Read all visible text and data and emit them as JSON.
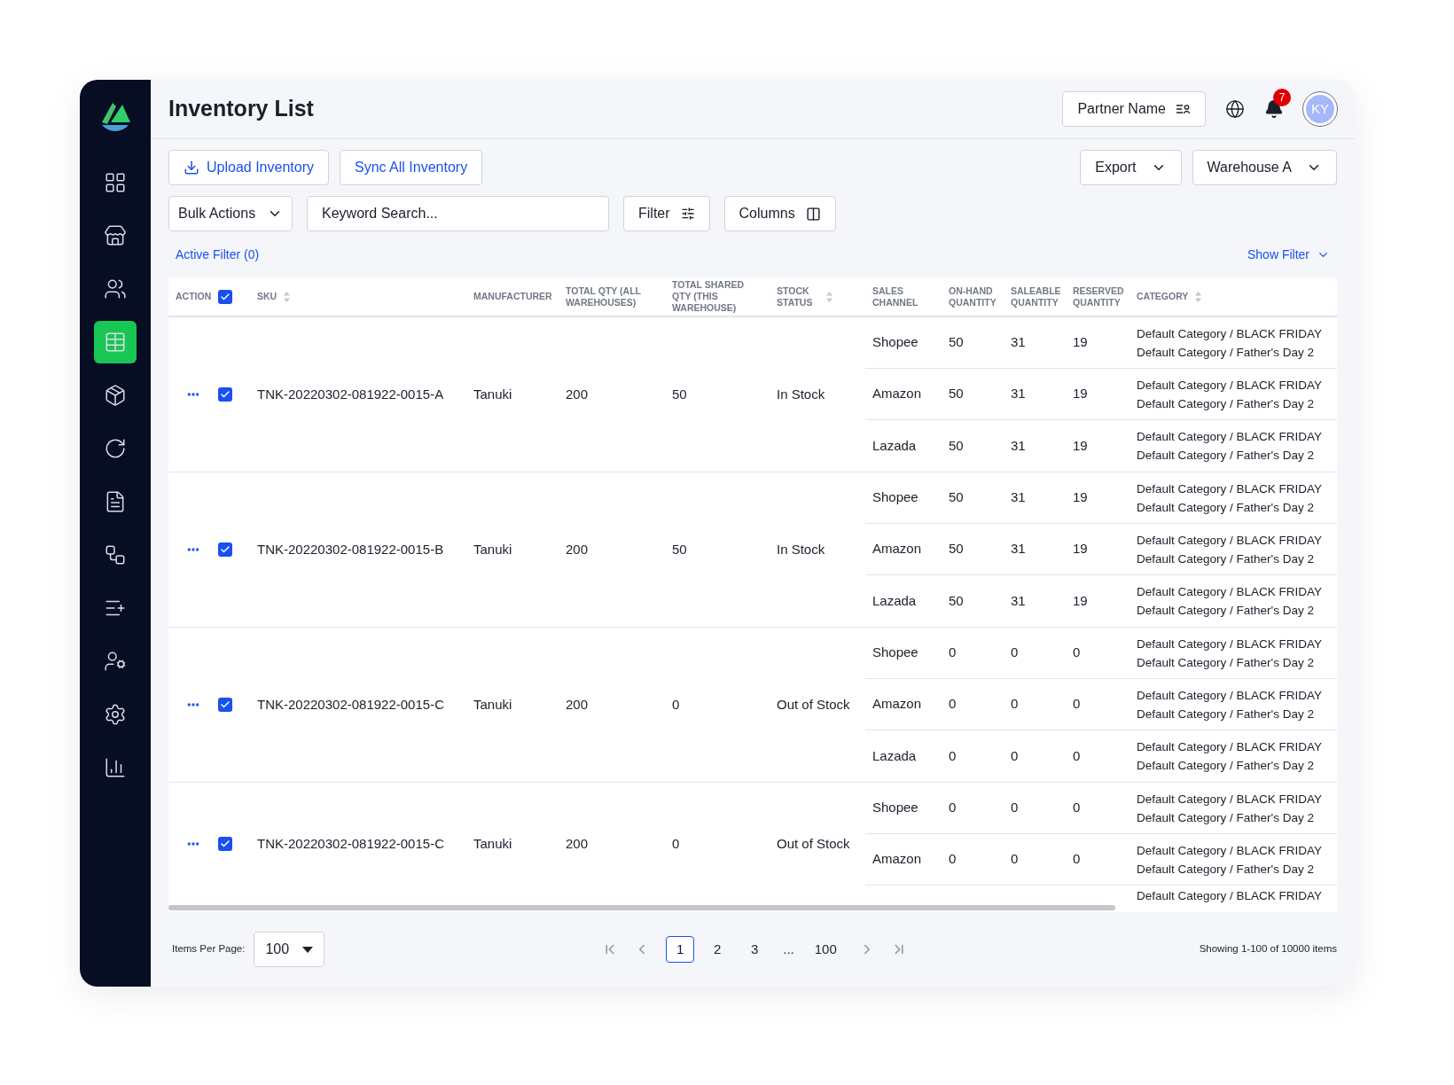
{
  "sidebar": {
    "items": [
      {
        "kind": "grid",
        "selected": false
      },
      {
        "kind": "store",
        "selected": false
      },
      {
        "kind": "users",
        "selected": false
      },
      {
        "kind": "table",
        "selected": true
      },
      {
        "kind": "package",
        "selected": false
      },
      {
        "kind": "refresh",
        "selected": false
      },
      {
        "kind": "document",
        "selected": false
      },
      {
        "kind": "workflow",
        "selected": false
      },
      {
        "kind": "list-add",
        "selected": false
      },
      {
        "kind": "user-star",
        "selected": false
      },
      {
        "kind": "settings",
        "selected": false
      },
      {
        "kind": "chart",
        "selected": false
      }
    ]
  },
  "header": {
    "title": "Inventory List",
    "partner_button": "Partner Name",
    "notification_count": "7",
    "avatar": "KY"
  },
  "toolbar": {
    "upload_button": "Upload Inventory",
    "sync_button": "Sync All Inventory",
    "export_button": "Export",
    "warehouse_button": "Warehouse A",
    "bulk_actions": "Bulk Actions",
    "search": {
      "placeholder": "Keyword Search..."
    },
    "filter_button": "Filter",
    "columns_button": "Columns",
    "active_filter": "Active Filter (0)",
    "show_filter": "Show Filter"
  },
  "table": {
    "select_all_checked": true,
    "columns": [
      {
        "label": "ACTION",
        "kind": "plain"
      },
      {
        "kind": "checkbox"
      },
      {
        "label": "SKU",
        "kind": "sortable"
      },
      {
        "label": "MANUFACTURER",
        "kind": "plain"
      },
      {
        "label": "TOTAL QTY (ALL WAREHOUSES)",
        "kind": "plain"
      },
      {
        "label": "TOTAL SHARED QTY (THIS WAREHOUSE)",
        "kind": "plain"
      },
      {
        "label": "STOCK STATUS",
        "kind": "sortable"
      },
      {
        "label": "SALES CHANNEL",
        "kind": "plain"
      },
      {
        "label": "ON-HAND QUANTITY",
        "kind": "plain"
      },
      {
        "label": "SALEABLE QUANTITY",
        "kind": "plain"
      },
      {
        "label": "RESERVED QUANTITY",
        "kind": "plain"
      },
      {
        "label": "CATEGORY",
        "kind": "sortable"
      }
    ],
    "rows": [
      {
        "checked": true,
        "sku": "TNK-20220302-081922-0015-A",
        "manufacturer": "Tanuki",
        "total_qty": "200",
        "total_shared_qty": "50",
        "stock_status": "In Stock",
        "channels": [
          {
            "channel": "Shopee",
            "on_hand": "50",
            "saleable": "31",
            "reserved": "19",
            "categories": [
              "Default Category / BLACK FRIDAY",
              "Default Category / Father's Day 2"
            ]
          },
          {
            "channel": "Amazon",
            "on_hand": "50",
            "saleable": "31",
            "reserved": "19",
            "categories": [
              "Default Category / BLACK FRIDAY",
              "Default Category / Father's Day 2"
            ]
          },
          {
            "channel": "Lazada",
            "on_hand": "50",
            "saleable": "31",
            "reserved": "19",
            "categories": [
              "Default Category / BLACK FRIDAY",
              "Default Category / Father's Day 2"
            ]
          }
        ]
      },
      {
        "checked": true,
        "sku": "TNK-20220302-081922-0015-B",
        "manufacturer": "Tanuki",
        "total_qty": "200",
        "total_shared_qty": "50",
        "stock_status": "In Stock",
        "channels": [
          {
            "channel": "Shopee",
            "on_hand": "50",
            "saleable": "31",
            "reserved": "19",
            "categories": [
              "Default Category / BLACK FRIDAY",
              "Default Category / Father's Day 2"
            ]
          },
          {
            "channel": "Amazon",
            "on_hand": "50",
            "saleable": "31",
            "reserved": "19",
            "categories": [
              "Default Category / BLACK FRIDAY",
              "Default Category / Father's Day 2"
            ]
          },
          {
            "channel": "Lazada",
            "on_hand": "50",
            "saleable": "31",
            "reserved": "19",
            "categories": [
              "Default Category / BLACK FRIDAY",
              "Default Category / Father's Day 2"
            ]
          }
        ]
      },
      {
        "checked": true,
        "sku": "TNK-20220302-081922-0015-C",
        "manufacturer": "Tanuki",
        "total_qty": "200",
        "total_shared_qty": "0",
        "stock_status": "Out of Stock",
        "channels": [
          {
            "channel": "Shopee",
            "on_hand": "0",
            "saleable": "0",
            "reserved": "0",
            "categories": [
              "Default Category / BLACK FRIDAY",
              "Default Category / Father's Day 2"
            ]
          },
          {
            "channel": "Amazon",
            "on_hand": "0",
            "saleable": "0",
            "reserved": "0",
            "categories": [
              "Default Category / BLACK FRIDAY",
              "Default Category / Father's Day 2"
            ]
          },
          {
            "channel": "Lazada",
            "on_hand": "0",
            "saleable": "0",
            "reserved": "0",
            "categories": [
              "Default Category / BLACK FRIDAY",
              "Default Category / Father's Day 2"
            ]
          }
        ]
      },
      {
        "checked": true,
        "sku": "TNK-20220302-081922-0015-C",
        "manufacturer": "Tanuki",
        "total_qty": "200",
        "total_shared_qty": "0",
        "stock_status": "Out of Stock",
        "channels": [
          {
            "channel": "Shopee",
            "on_hand": "0",
            "saleable": "0",
            "reserved": "0",
            "categories": [
              "Default Category / BLACK FRIDAY",
              "Default Category / Father's Day 2"
            ]
          },
          {
            "channel": "Amazon",
            "on_hand": "0",
            "saleable": "0",
            "reserved": "0",
            "categories": [
              "Default Category / BLACK FRIDAY",
              "Default Category / Father's Day 2"
            ]
          },
          {
            "categories": [
              "Default Category / BLACK FRIDAY"
            ]
          }
        ]
      }
    ]
  },
  "footer": {
    "items_per_page_label": "Items Per Page:",
    "items_per_page": "100",
    "pages": [
      {
        "label": "1",
        "kind": "page",
        "selected": true
      },
      {
        "label": "2",
        "kind": "page",
        "selected": false
      },
      {
        "label": "3",
        "kind": "page",
        "selected": false
      },
      {
        "label": "...",
        "kind": "ellipsis"
      },
      {
        "label": "100",
        "kind": "page",
        "selected": false
      }
    ],
    "showing": "Showing 1-100 of 10000 items"
  }
}
